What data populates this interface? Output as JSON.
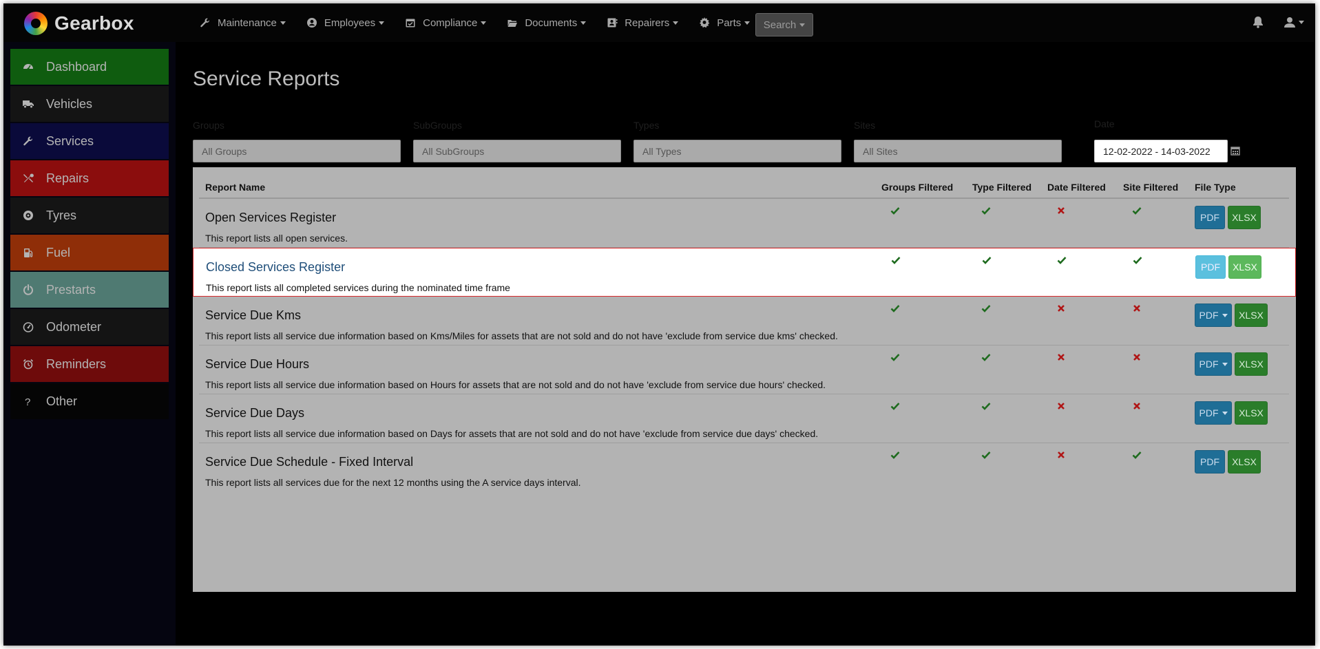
{
  "app": {
    "brand": "Gearbox"
  },
  "nav": [
    {
      "label": "Maintenance",
      "icon": "wrench-icon"
    },
    {
      "label": "Employees",
      "icon": "user-circle-icon"
    },
    {
      "label": "Compliance",
      "icon": "calendar-check-icon"
    },
    {
      "label": "Documents",
      "icon": "folder-open-icon"
    },
    {
      "label": "Repairers",
      "icon": "address-card-icon"
    },
    {
      "label": "Parts",
      "icon": "gear-icon"
    }
  ],
  "search": {
    "label": "Search"
  },
  "sidebar": {
    "items": [
      {
        "label": "Dashboard",
        "icon": "dashboard-icon",
        "color": "#0f5c0f"
      },
      {
        "label": "Vehicles",
        "icon": "truck-icon",
        "color": "#141414"
      },
      {
        "label": "Services",
        "icon": "wrench-icon",
        "color": "#0a0a3a"
      },
      {
        "label": "Repairs",
        "icon": "tools-icon",
        "color": "#8b0d0d"
      },
      {
        "label": "Tyres",
        "icon": "tyre-icon",
        "color": "#141414"
      },
      {
        "label": "Fuel",
        "icon": "fuel-icon",
        "color": "#8f2e08"
      },
      {
        "label": "Prestarts",
        "icon": "power-icon",
        "color": "#4f7a72"
      },
      {
        "label": "Odometer",
        "icon": "gauge-icon",
        "color": "#141414"
      },
      {
        "label": "Reminders",
        "icon": "alarm-clock-icon",
        "color": "#6e0b0b"
      },
      {
        "label": "Other",
        "icon": "question-icon",
        "color": "#050505"
      }
    ]
  },
  "page": {
    "title": "Service Reports"
  },
  "filters": {
    "groups": {
      "label": "Groups",
      "value": "All Groups"
    },
    "subgroups": {
      "label": "SubGroups",
      "value": "All SubGroups"
    },
    "types": {
      "label": "Types",
      "value": "All Types"
    },
    "sites": {
      "label": "Sites",
      "value": "All Sites"
    },
    "date": {
      "label": "Date",
      "value": "12-02-2022 - 14-03-2022"
    }
  },
  "table": {
    "headers": {
      "report_name": "Report Name",
      "groups_filtered": "Groups Filtered",
      "type_filtered": "Type Filtered",
      "date_filtered": "Date Filtered",
      "site_filtered": "Site Filtered",
      "file_type": "File Type"
    },
    "rows": [
      {
        "title": "Open Services Register",
        "desc": "This report lists all open services.",
        "groups": true,
        "type": true,
        "date": false,
        "site": true,
        "pdf": "PDF",
        "pdf_dropdown": false,
        "xlsx": "XLSX"
      },
      {
        "title": "Closed Services Register",
        "desc": "This report lists all completed services during the nominated time frame",
        "groups": true,
        "type": true,
        "date": true,
        "site": true,
        "pdf": "PDF",
        "pdf_dropdown": false,
        "xlsx": "XLSX",
        "highlighted": true
      },
      {
        "title": "Service Due Kms",
        "desc": "This report lists all service due information based on Kms/Miles for assets that are not sold and do not have 'exclude from service due kms' checked.",
        "groups": true,
        "type": true,
        "date": false,
        "site": false,
        "pdf": "PDF",
        "pdf_dropdown": true,
        "xlsx": "XLSX"
      },
      {
        "title": "Service Due Hours",
        "desc": "This report lists all service due information based on Hours for assets that are not sold and do not have 'exclude from service due hours' checked.",
        "groups": true,
        "type": true,
        "date": false,
        "site": false,
        "pdf": "PDF",
        "pdf_dropdown": true,
        "xlsx": "XLSX"
      },
      {
        "title": "Service Due Days",
        "desc": "This report lists all service due information based on Days for assets that are not sold and do not have 'exclude from service due days' checked.",
        "groups": true,
        "type": true,
        "date": false,
        "site": false,
        "pdf": "PDF",
        "pdf_dropdown": true,
        "xlsx": "XLSX"
      },
      {
        "title": "Service Due Schedule - Fixed Interval",
        "desc": "This report lists all services due for the next 12 months using the A service days interval.",
        "groups": true,
        "type": true,
        "date": false,
        "site": true,
        "pdf": "PDF",
        "pdf_dropdown": false,
        "xlsx": "XLSX"
      }
    ]
  },
  "colors": {
    "check": "#1e6b1e",
    "cross": "#b01515",
    "highlight_border": "#d9292c"
  }
}
